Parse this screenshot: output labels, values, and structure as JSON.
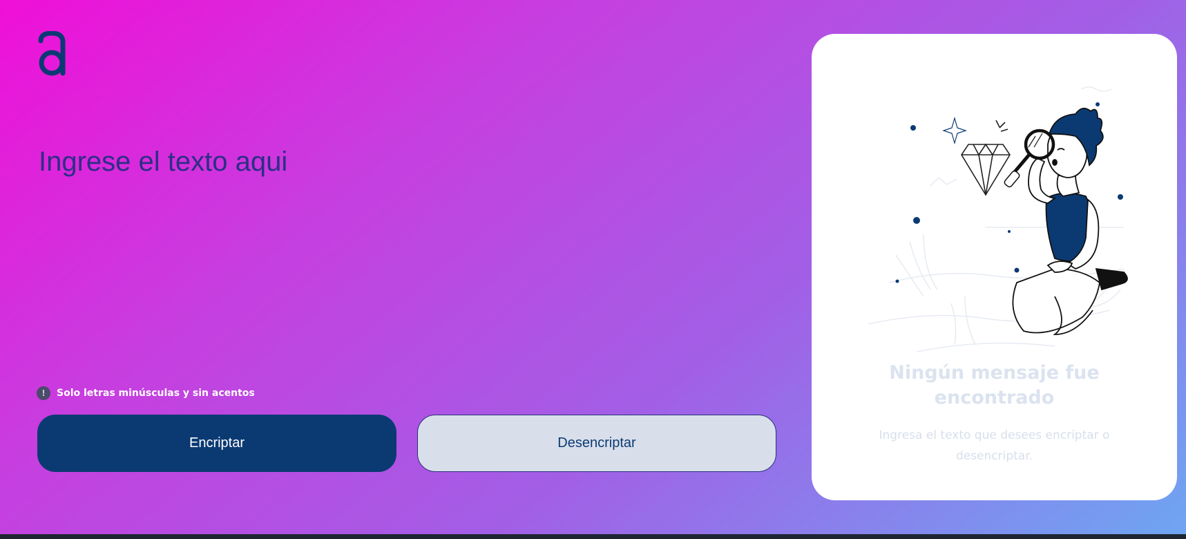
{
  "input": {
    "placeholder": "Ingrese el texto aqui",
    "value": ""
  },
  "hint": {
    "icon": "exclamation-circle-icon",
    "icon_glyph": "!",
    "text": "Solo letras minúsculas y sin acentos"
  },
  "buttons": {
    "encrypt_label": "Encriptar",
    "decrypt_label": "Desencriptar"
  },
  "output": {
    "title": "Ningún mensaje fue encontrado",
    "message": "Ingresa el texto que desees encriptar o desencriptar."
  },
  "colors": {
    "gradient_start": "#f00fd8",
    "gradient_end": "#6ea6f2",
    "primary": "#0b3a73",
    "secondary": "#d8dfeb",
    "placeholder_text": "#2b2f86"
  }
}
